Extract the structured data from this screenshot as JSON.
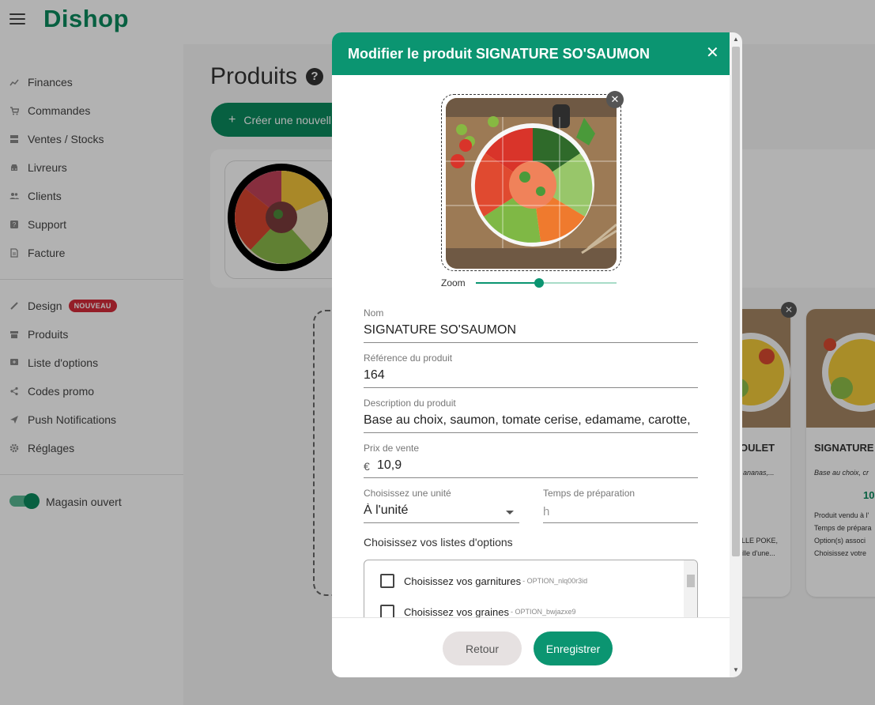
{
  "app": {
    "logo": "Dishop"
  },
  "colors": {
    "brand": "#0b8a5e",
    "modal_header": "#0b9571",
    "badge": "#d52b3a"
  },
  "sidebar": {
    "items": [
      {
        "label": "Finances",
        "icon": "chart-line-icon"
      },
      {
        "label": "Commandes",
        "icon": "cart-icon"
      },
      {
        "label": "Ventes / Stocks",
        "icon": "storage-icon"
      },
      {
        "label": "Livreurs",
        "icon": "car-icon"
      },
      {
        "label": "Clients",
        "icon": "people-icon"
      },
      {
        "label": "Support",
        "icon": "help-box-icon"
      },
      {
        "label": "Facture",
        "icon": "invoice-icon"
      },
      {
        "label": "Design",
        "icon": "brush-icon",
        "badge": "NOUVEAU"
      },
      {
        "label": "Produits",
        "icon": "store-icon"
      },
      {
        "label": "Liste d'options",
        "icon": "list-add-icon"
      },
      {
        "label": "Codes promo",
        "icon": "share-icon"
      },
      {
        "label": "Push Notifications",
        "icon": "send-icon"
      },
      {
        "label": "Réglages",
        "icon": "gear-icon"
      }
    ],
    "store_toggle": {
      "label": "Magasin ouvert",
      "on": true
    }
  },
  "main": {
    "title": "Produits",
    "create_button": "Créer une nouvell",
    "cards": [
      {
        "name": "OULET",
        "desc": "ananas,...",
        "meta": [
          "LLE POKE,",
          "ille d'une..."
        ]
      },
      {
        "name": "SIGNATURE",
        "desc": "Base au choix, cr",
        "price": "10",
        "meta": [
          "Produit vendu à l'",
          "Temps de prépara",
          "Option(s) associ",
          "Choisissez votre"
        ]
      }
    ]
  },
  "modal": {
    "title": "Modifier le produit SIGNATURE SO'SAUMON",
    "zoom_label": "Zoom",
    "zoom_level": 0.45,
    "fields": {
      "nom": {
        "label": "Nom",
        "value": "SIGNATURE SO'SAUMON"
      },
      "reference": {
        "label": "Référence du produit",
        "value": "164"
      },
      "description": {
        "label": "Description du produit",
        "value": "Base au choix, saumon, tomate cerise, edamame, carotte,"
      },
      "prix": {
        "label": "Prix de vente",
        "currency": "€",
        "value": "10,9"
      },
      "unite": {
        "label": "Choisissez une unité",
        "value": "À l'unité"
      },
      "temps": {
        "label": "Temps de préparation",
        "placeholder": "h"
      }
    },
    "options_title": "Choisissez vos listes d'options",
    "options": [
      {
        "label": "Choisissez vos garnitures",
        "code": "- OPTION_nlq00r3id",
        "checked": false
      },
      {
        "label": "Choisissez vos graines",
        "code": "- OPTION_bwjazxe9",
        "checked": false
      }
    ],
    "buttons": {
      "back": "Retour",
      "save": "Enregistrer"
    }
  }
}
